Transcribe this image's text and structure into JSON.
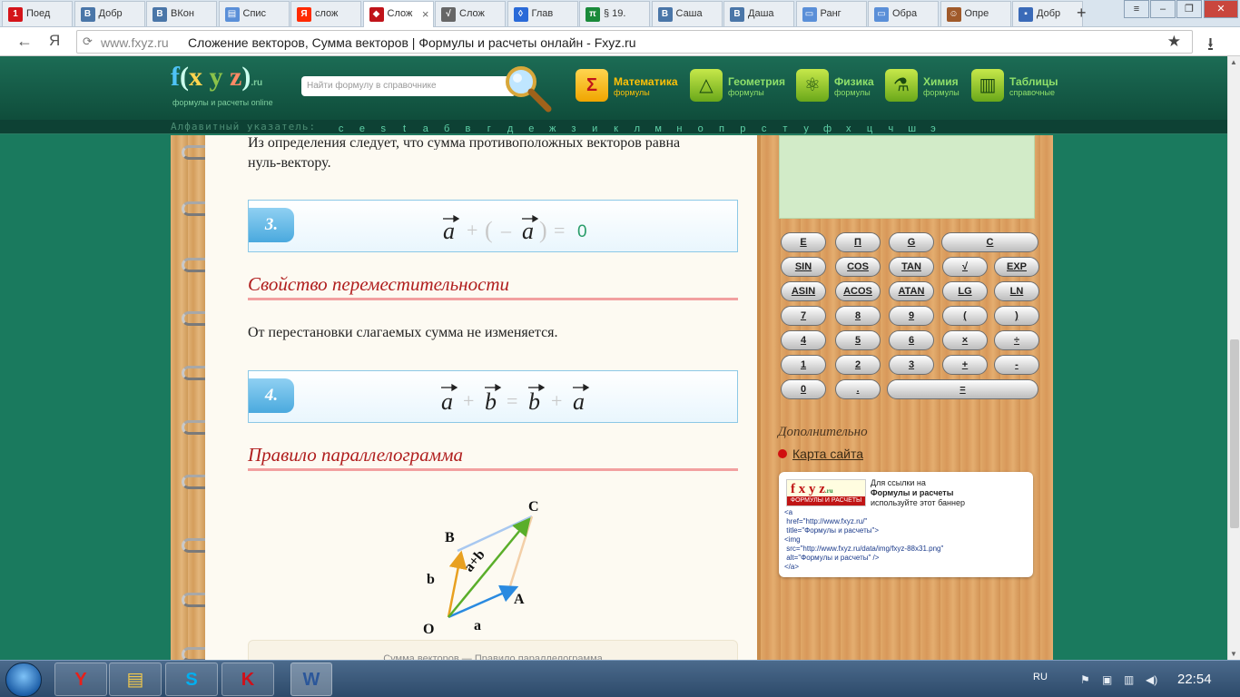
{
  "browser": {
    "tabs": [
      {
        "label": "Поед",
        "icon": "1",
        "icon_color": "#d4141a"
      },
      {
        "label": "Добр",
        "icon": "В",
        "icon_color": "#4a76a8"
      },
      {
        "label": "ВКон",
        "icon": "В",
        "icon_color": "#4a76a8"
      },
      {
        "label": "Спис",
        "icon": "▤",
        "icon_color": "#5a8fd8"
      },
      {
        "label": "слож",
        "icon": "Я",
        "icon_color": "#ff2a00"
      },
      {
        "label": "Слож",
        "icon": "◆",
        "icon_color": "#c0141a",
        "active": true
      },
      {
        "label": "Слож",
        "icon": "√",
        "icon_color": "#666666"
      },
      {
        "label": "Глав",
        "icon": "◊",
        "icon_color": "#2a6ad8"
      },
      {
        "label": "§ 19.",
        "icon": "π",
        "icon_color": "#1a8a3a"
      },
      {
        "label": "Саша",
        "icon": "В",
        "icon_color": "#4a76a8"
      },
      {
        "label": "Даша",
        "icon": "В",
        "icon_color": "#4a76a8"
      },
      {
        "label": "Ранг",
        "icon": "▭",
        "icon_color": "#5a8fd8"
      },
      {
        "label": "Обра",
        "icon": "▭",
        "icon_color": "#5a8fd8"
      },
      {
        "label": "Опре",
        "icon": "☺",
        "icon_color": "#a05a2a"
      },
      {
        "label": "Добр",
        "icon": "▪",
        "icon_color": "#3a6ab8"
      }
    ],
    "new_tab": "+",
    "window_controls": [
      "≡",
      "–",
      "❐",
      "✕"
    ],
    "address": {
      "host": "www.fxyz.ru",
      "title": "Сложение векторов, Сумма векторов | Формулы и расчеты онлайн - Fxyz.ru",
      "star": "★",
      "download": "⭳"
    },
    "nav": {
      "back": "←",
      "yandex": "Я"
    }
  },
  "site": {
    "logo": {
      "f": "f",
      "x": "x",
      "y": "y",
      "z": "z",
      "ru": ".ru",
      "subtitle": "формулы и расчеты online"
    },
    "search_placeholder": "Найти формулу в справочнике",
    "categories": [
      {
        "label": "Математика",
        "sub": "формулы",
        "icon": "Σ",
        "label_color": "#ffc107"
      },
      {
        "label": "Геометрия",
        "sub": "формулы",
        "icon": "△",
        "label_color": "#8fe06a"
      },
      {
        "label": "Физика",
        "sub": "формулы",
        "icon": "⚛",
        "label_color": "#8fe06a"
      },
      {
        "label": "Химия",
        "sub": "формулы",
        "icon": "⚗",
        "label_color": "#8fe06a"
      },
      {
        "label": "Таблицы",
        "sub": "справочные",
        "icon": "▥",
        "label_color": "#8fe06a"
      }
    ],
    "alphabet_label": "Алфавитный указатель:",
    "alphabet": [
      "c",
      "e",
      "s",
      "t",
      "а",
      "б",
      "в",
      "г",
      "д",
      "е",
      "ж",
      "з",
      "и",
      "к",
      "л",
      "м",
      "н",
      "о",
      "п",
      "р",
      "с",
      "т",
      "у",
      "ф",
      "х",
      "ц",
      "ч",
      "ш",
      "э"
    ]
  },
  "content": {
    "intro_line1": "Из определения следует, что сумма противоположных векторов равна",
    "intro_line2": "нуль-вектору.",
    "formula3": {
      "number": "3.",
      "vec": "a",
      "plus": "+",
      "lparen": "(",
      "minus": "–",
      "rparen": ")",
      "eq": "=",
      "zero": "0"
    },
    "section_commutative": "Свойство переместительности",
    "commutative_text": "От перестановки слагаемых сумма не изменяется.",
    "formula4": {
      "number": "4.",
      "a": "a",
      "b": "b",
      "plus": "+",
      "eq": "="
    },
    "section_parallelogram": "Правило параллелограмма",
    "figure_labels": {
      "O": "O",
      "A": "A",
      "B": "B",
      "C": "C",
      "a": "a",
      "b": "b",
      "sum": "a+b"
    },
    "caption": "Сумма векторов — Правило параллелограмма"
  },
  "sidebar": {
    "calc_rows": [
      [
        "E",
        "П",
        "G",
        "C"
      ],
      [
        "SIN",
        "COS",
        "TAN",
        "√",
        "EXP"
      ],
      [
        "ASIN",
        "ACOS",
        "ATAN",
        "LG",
        "LN"
      ],
      [
        "7",
        "8",
        "9",
        "(",
        ")"
      ],
      [
        "4",
        "5",
        "6",
        "×",
        "÷"
      ],
      [
        "1",
        "2",
        "3",
        "+",
        "-"
      ],
      [
        "0",
        ".",
        "="
      ]
    ],
    "extra_title": "Дополнительно",
    "sitemap": "Карта сайта",
    "banner": {
      "logo": "f x y z",
      "logo_ru": ".ru",
      "logo_sub": "ФОРМУЛЫ И РАСЧЕТЫ",
      "line1": "Для ссылки на",
      "line2": "Формулы и расчеты",
      "line3": "используйте этот баннер",
      "code": "<a\n href=\"http://www.fxyz.ru/\"\n title=\"Формулы и расчеты\">\n<img\n src=\"http://www.fxyz.ru/data/img/fxyz-88x31.png\"\n alt=\"Формулы и расчеты\" />\n</a>"
    }
  },
  "taskbar": {
    "apps": [
      {
        "name": "yandex",
        "glyph": "Y",
        "color": "#e8201a"
      },
      {
        "name": "explorer",
        "glyph": "▤",
        "color": "#f2c94c"
      },
      {
        "name": "skype",
        "glyph": "S",
        "color": "#00aff0"
      },
      {
        "name": "kaspersky",
        "glyph": "K",
        "color": "#d0101a"
      },
      {
        "name": "word",
        "glyph": "W",
        "color": "#2b579a"
      }
    ],
    "lang": "RU",
    "time": "22:54"
  }
}
